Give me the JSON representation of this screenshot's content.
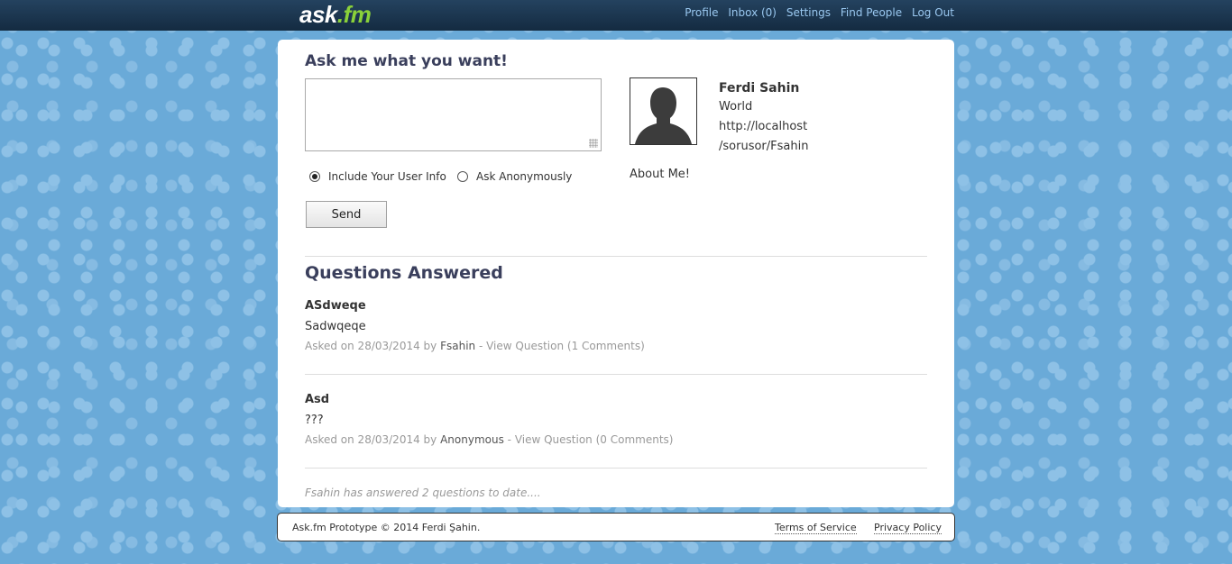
{
  "header": {
    "logo_ask": "ask",
    "logo_fm": ".fm",
    "nav": [
      "Profile",
      "Inbox (0)",
      "Settings",
      "Find People",
      "Log Out"
    ]
  },
  "ask_form": {
    "title": "Ask me what you want!",
    "question_value": "",
    "include_user_info_label": "Include Your User Info",
    "ask_anonymously_label": "Ask Anonymously",
    "selected_option": "include_user_info",
    "send_label": "Send"
  },
  "profile": {
    "name": "Ferdi Sahin",
    "location": "World",
    "url_line1": "http://localhost",
    "url_line2": "/sorusor/Fsahin",
    "about": "About Me!",
    "avatar_icon": "user-silhouette-icon"
  },
  "answered": {
    "title": "Questions Answered",
    "questions": [
      {
        "question": "ASdweqe",
        "answer": "Sadwqeqe",
        "asked_prefix": "Asked on 28/03/2014 by ",
        "asked_by": "Fsahin",
        "separator": " - ",
        "view_link": "View Question",
        "comments": " (1 Comments)"
      },
      {
        "question": "Asd",
        "answer": "???",
        "asked_prefix": "Asked on 28/03/2014 by ",
        "asked_by": "Anonymous",
        "separator": " - ",
        "view_link": "View Question",
        "comments": " (0 Comments)"
      }
    ],
    "summary": "Fsahin has answered 2 questions to date...."
  },
  "footer": {
    "copyright": "Ask.fm Prototype © 2014 Ferdi Şahin.",
    "terms": "Terms of Service",
    "privacy": "Privacy Policy"
  },
  "colors": {
    "background": "#6aaad8",
    "topbar": "#1c344d",
    "nav_link": "#9ac8f0",
    "logo_accent": "#8ad13a",
    "heading": "#3a3f5c"
  }
}
